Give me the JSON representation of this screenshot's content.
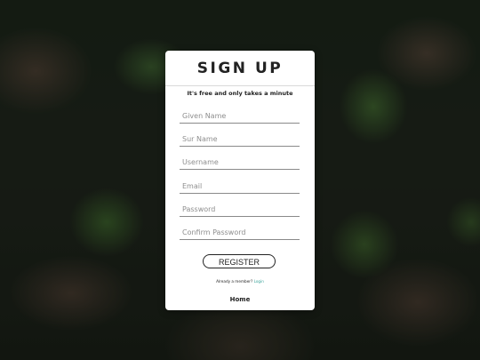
{
  "card": {
    "title": "SIGN UP",
    "subtitle": "It's free and only takes a minute"
  },
  "fields": {
    "given_name": {
      "placeholder": "Given Name",
      "value": ""
    },
    "sur_name": {
      "placeholder": "Sur Name",
      "value": ""
    },
    "username": {
      "placeholder": "Username",
      "value": ""
    },
    "email": {
      "placeholder": "Email",
      "value": ""
    },
    "password": {
      "placeholder": "Password",
      "value": ""
    },
    "confirm_password": {
      "placeholder": "Confirm Password",
      "value": ""
    }
  },
  "register_label": "REGISTER",
  "member": {
    "text": "Already a member?",
    "login_label": "Login"
  },
  "home_label": "Home",
  "colors": {
    "card_background": "#ffffff",
    "text": "#222222",
    "login_link": "#3aa39a"
  }
}
